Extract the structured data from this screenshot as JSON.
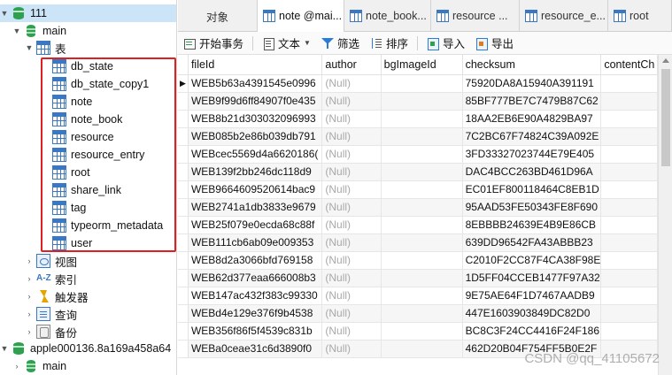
{
  "tree": {
    "root_label": "111",
    "schema_label": "main",
    "tables_group_label": "表",
    "tables": [
      "db_state",
      "db_state_copy1",
      "note",
      "note_book",
      "resource",
      "resource_entry",
      "root",
      "share_link",
      "tag",
      "typeorm_metadata",
      "user"
    ],
    "groups": [
      {
        "label": "视图",
        "icon": "view-icon"
      },
      {
        "label": "索引",
        "icon": "index-icon"
      },
      {
        "label": "触发器",
        "icon": "trigger-icon"
      },
      {
        "label": "查询",
        "icon": "query-icon"
      },
      {
        "label": "备份",
        "icon": "backup-icon"
      }
    ],
    "second_connection_label": "apple000136.8a169a458a64",
    "second_schema_label": "main",
    "highlight_color": "#e02020"
  },
  "tabs": [
    {
      "label": "对象",
      "active": false,
      "icon": false
    },
    {
      "label": "note @mai...",
      "active": true,
      "icon": true
    },
    {
      "label": "note_book...",
      "active": false,
      "icon": true
    },
    {
      "label": "resource ...",
      "active": false,
      "icon": true
    },
    {
      "label": "resource_e...",
      "active": false,
      "icon": true
    },
    {
      "label": "root",
      "active": false,
      "icon": true
    }
  ],
  "toolbar": {
    "begin_transaction": "开始事务",
    "text": "文本",
    "filter": "筛选",
    "sort": "排序",
    "import": "导入",
    "export": "导出"
  },
  "grid": {
    "columns": [
      "fileId",
      "author",
      "bgImageId",
      "checksum",
      "contentCh"
    ],
    "null_text": "(Null)",
    "current_row_marker": "▶",
    "rows": [
      [
        "WEB5b63a4391545e0996",
        "(Null)",
        "",
        "75920DA8A15940A391191"
      ],
      [
        "WEB9f99d6ff84907f0e435",
        "(Null)",
        "",
        "85BF777BE7C7479B87C62"
      ],
      [
        "WEB8b21d303032096993",
        "(Null)",
        "",
        "18AA2EB6E90A4829BA97"
      ],
      [
        "WEB085b2e86b039db791",
        "(Null)",
        "",
        "7C2BC67F74824C39A092E"
      ],
      [
        "WEBcec5569d4a6620186(",
        "(Null)",
        "",
        "3FD33327023744E79E405"
      ],
      [
        "WEB139f2bb246dc118d9",
        "(Null)",
        "",
        "DAC4BCC263BD461D96A"
      ],
      [
        "WEB9664609520614bac9",
        "(Null)",
        "",
        "EC01EF800118464C8EB1D"
      ],
      [
        "WEB2741a1db3833e9679",
        "(Null)",
        "",
        "95AAD53FE50343FE8F690"
      ],
      [
        "WEB25f079e0ecda68c88f",
        "(Null)",
        "",
        "8EBBBB24639E4B9E86CB"
      ],
      [
        "WEB111cb6ab09e009353",
        "(Null)",
        "",
        "639DD96542FA43ABBB23"
      ],
      [
        "WEB8d2a3066bfd769158",
        "(Null)",
        "",
        "C2010F2CC87F4CA38F98E"
      ],
      [
        "WEB62d377eaa666008b3",
        "(Null)",
        "",
        "1D5FF04CCEB1477F97A32"
      ],
      [
        "WEB147ac432f383c99330",
        "(Null)",
        "",
        "9E75AE64F1D7467AADB9"
      ],
      [
        "WEBd4e129e376f9b4538",
        "(Null)",
        "",
        "447E1603903849DC82D0"
      ],
      [
        "WEB356f86f5f4539c831b",
        "(Null)",
        "",
        "BC8C3F24CC4416F24F186"
      ],
      [
        "WEBa0ceae31c6d3890f0",
        "(Null)",
        "",
        "462D20B04F754FF5B0E2F"
      ]
    ]
  },
  "watermark": "CSDN @qq_41105672"
}
